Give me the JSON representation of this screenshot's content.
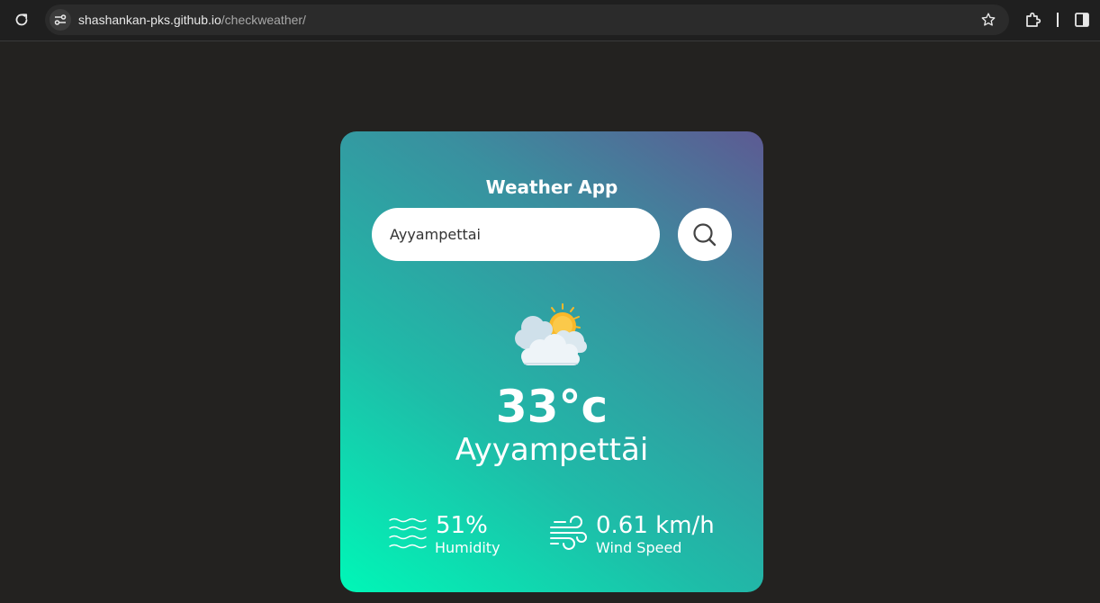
{
  "browser": {
    "url_host": "shashankan-pks.github.io",
    "url_path": "/checkweather/",
    "icons": [
      "reload-icon",
      "site-info-icon",
      "star-icon",
      "extensions-icon",
      "side-panel-icon"
    ]
  },
  "app": {
    "title": "Weather App",
    "search": {
      "value": "Ayyampettai",
      "placeholder": ""
    },
    "weather": {
      "icon": "sun-behind-clouds-icon",
      "temperature": "33°c",
      "city": "Ayyampettāi"
    },
    "humidity": {
      "icon": "waves-icon",
      "value": "51%",
      "label": "Humidity"
    },
    "wind": {
      "icon": "wind-icon",
      "value": "0.61 km/h",
      "label": "Wind Speed"
    }
  },
  "colors": {
    "page_background": "#232220",
    "card_gradient": [
      "#00f7b7",
      "#1fbba8",
      "#3a8f9f",
      "#5d5a93"
    ],
    "sun": "#f9b829",
    "cloud": "#eef4f8"
  }
}
